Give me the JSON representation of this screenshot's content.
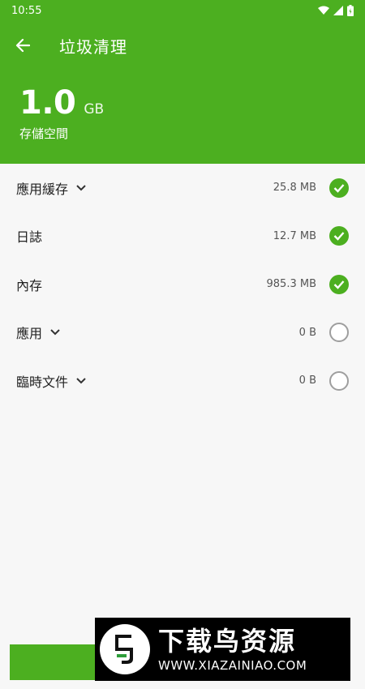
{
  "status_bar": {
    "time": "10:55"
  },
  "app_bar": {
    "title": "垃圾清理"
  },
  "storage": {
    "value": "1.0",
    "unit": "GB",
    "label": "存儲空間"
  },
  "items": [
    {
      "label": "應用緩存",
      "size": "25.8 MB",
      "expandable": true,
      "checked": true
    },
    {
      "label": "日誌",
      "size": "12.7 MB",
      "expandable": false,
      "checked": true
    },
    {
      "label": "內存",
      "size": "985.3 MB",
      "expandable": false,
      "checked": true
    },
    {
      "label": "應用",
      "size": "0 B",
      "expandable": true,
      "checked": false
    },
    {
      "label": "臨時文件",
      "size": "0 B",
      "expandable": true,
      "checked": false
    }
  ],
  "watermark": {
    "title": "下载鸟资源",
    "url": "WWW.XIAZAINIAO.COM"
  },
  "colors": {
    "accent": "#4caf20"
  }
}
